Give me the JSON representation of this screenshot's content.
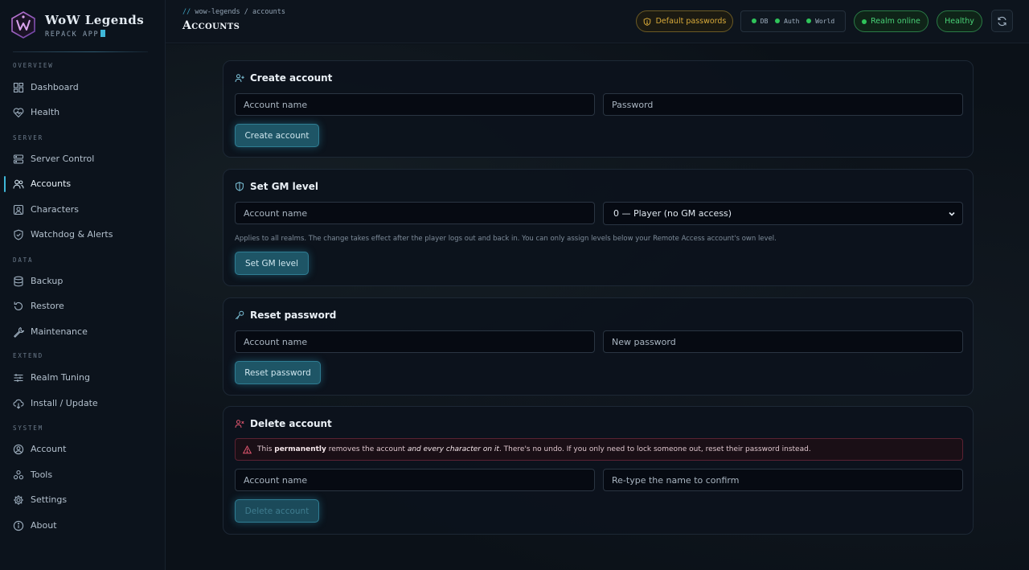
{
  "brand": {
    "title": "WoW Legends",
    "subtitle": "REPACK APP"
  },
  "sidebar": {
    "sections": [
      {
        "label": "OVERVIEW",
        "items": [
          {
            "label": "Dashboard",
            "icon": "dashboard-icon"
          },
          {
            "label": "Health",
            "icon": "heart-pulse-icon"
          }
        ]
      },
      {
        "label": "SERVER",
        "items": [
          {
            "label": "Server Control",
            "icon": "server-icon"
          },
          {
            "label": "Accounts",
            "icon": "users-icon",
            "active": true
          },
          {
            "label": "Characters",
            "icon": "character-icon"
          },
          {
            "label": "Watchdog & Alerts",
            "icon": "shield-check-icon"
          }
        ]
      },
      {
        "label": "DATA",
        "items": [
          {
            "label": "Backup",
            "icon": "database-icon"
          },
          {
            "label": "Restore",
            "icon": "restore-icon"
          },
          {
            "label": "Maintenance",
            "icon": "wrench-icon"
          }
        ]
      },
      {
        "label": "EXTEND",
        "items": [
          {
            "label": "Realm Tuning",
            "icon": "sliders-icon"
          },
          {
            "label": "Install / Update",
            "icon": "cloud-download-icon"
          }
        ]
      },
      {
        "label": "SYSTEM",
        "items": [
          {
            "label": "Account",
            "icon": "user-circle-icon"
          },
          {
            "label": "Tools",
            "icon": "tools-icon"
          },
          {
            "label": "Settings",
            "icon": "gear-icon"
          },
          {
            "label": "About",
            "icon": "info-icon"
          }
        ]
      }
    ]
  },
  "header": {
    "breadcrumb_prefix": "//",
    "breadcrumb": "wow-legends / accounts",
    "title": "Accounts",
    "default_passwords": "Default passwords",
    "services": [
      {
        "label": "DB",
        "status_color": "#2fc45a"
      },
      {
        "label": "Auth",
        "status_color": "#2fc45a"
      },
      {
        "label": "World",
        "status_color": "#2fc45a"
      }
    ],
    "realm_status": "Realm online",
    "health": "Healthy"
  },
  "create_account": {
    "title": "Create account",
    "name_placeholder": "Account name",
    "password_placeholder": "Password",
    "button": "Create account"
  },
  "set_gm": {
    "title": "Set GM level",
    "name_placeholder": "Account name",
    "level_selected": "0 — Player (no GM access)",
    "hint": "Applies to all realms. The change takes effect after the player logs out and back in. You can only assign levels below your Remote Access account's own level.",
    "button": "Set GM level"
  },
  "reset_password": {
    "title": "Reset password",
    "name_placeholder": "Account name",
    "password_placeholder": "New password",
    "button": "Reset password"
  },
  "delete_account": {
    "title": "Delete account",
    "warning_pre": "This ",
    "warning_bold": "permanently",
    "warning_mid": " removes the account ",
    "warning_em": "and every character on it",
    "warning_post": ". There's no undo. If you only need to lock someone out, reset their password instead.",
    "name_placeholder": "Account name",
    "confirm_placeholder": "Re-type the name to confirm",
    "button": "Delete account"
  },
  "colors": {
    "accent": "#3fb7d8",
    "success": "#2fc45a",
    "warning": "#d8aa3a",
    "danger": "#e0566f"
  }
}
